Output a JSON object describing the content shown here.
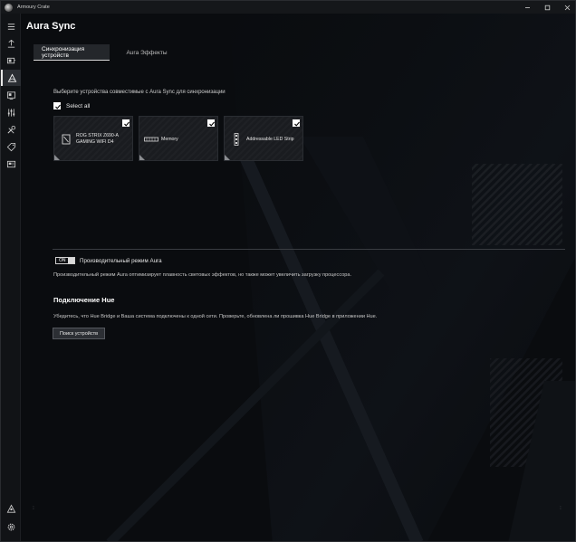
{
  "window": {
    "app_title": "Armoury Crate",
    "controls": [
      "minimize",
      "maximize",
      "close"
    ]
  },
  "sidebar": {
    "items": [
      {
        "icon": "menu-icon",
        "active": false
      },
      {
        "icon": "home-icon",
        "active": false
      },
      {
        "icon": "device-icon",
        "active": false
      },
      {
        "icon": "aura-sync-icon",
        "active": true
      },
      {
        "icon": "gamevisual-icon",
        "active": false
      },
      {
        "icon": "scenario-icon",
        "active": false
      },
      {
        "icon": "tools-icon",
        "active": false
      },
      {
        "icon": "deals-icon",
        "active": false
      },
      {
        "icon": "news-icon",
        "active": false
      },
      {
        "icon": "user-icon",
        "active": false
      },
      {
        "icon": "settings-icon",
        "active": false
      }
    ]
  },
  "page": {
    "title": "Aura Sync",
    "tabs": [
      {
        "label": "Синхронизация устройств",
        "active": true
      },
      {
        "label": "Aura Эффекты",
        "active": false
      }
    ],
    "instruction": "Выберите устройства совместимые с Aura Sync для синхронизации",
    "select_all_label": "Select all",
    "devices": [
      {
        "name": "ROG STRIX Z690-A GAMING WIFI D4",
        "icon": "motherboard-icon",
        "checked": true
      },
      {
        "name": "Memory",
        "icon": "memory-icon",
        "checked": true
      },
      {
        "name": "Addressable LED Strip",
        "icon": "led-strip-icon",
        "checked": true
      }
    ],
    "performance": {
      "toggle_state": "ON",
      "label": "Производительный режим Aura",
      "description": "Производительный режим Aura оптимизирует плавность световых эффектов, но также может увеличить загрузку процессора."
    },
    "hue": {
      "title": "Подключение Hue",
      "description": "Убедитесь, что Hue Bridge и Ваша система подключены к одной сети. Проверьте, обновлена ли прошивка Hue Bridge в приложении Hue.",
      "search_button": "Поиск устройств"
    }
  },
  "colors": {
    "background": "#0a0c0f",
    "sidebar": "#111316",
    "accent": "#e8e8e8"
  }
}
